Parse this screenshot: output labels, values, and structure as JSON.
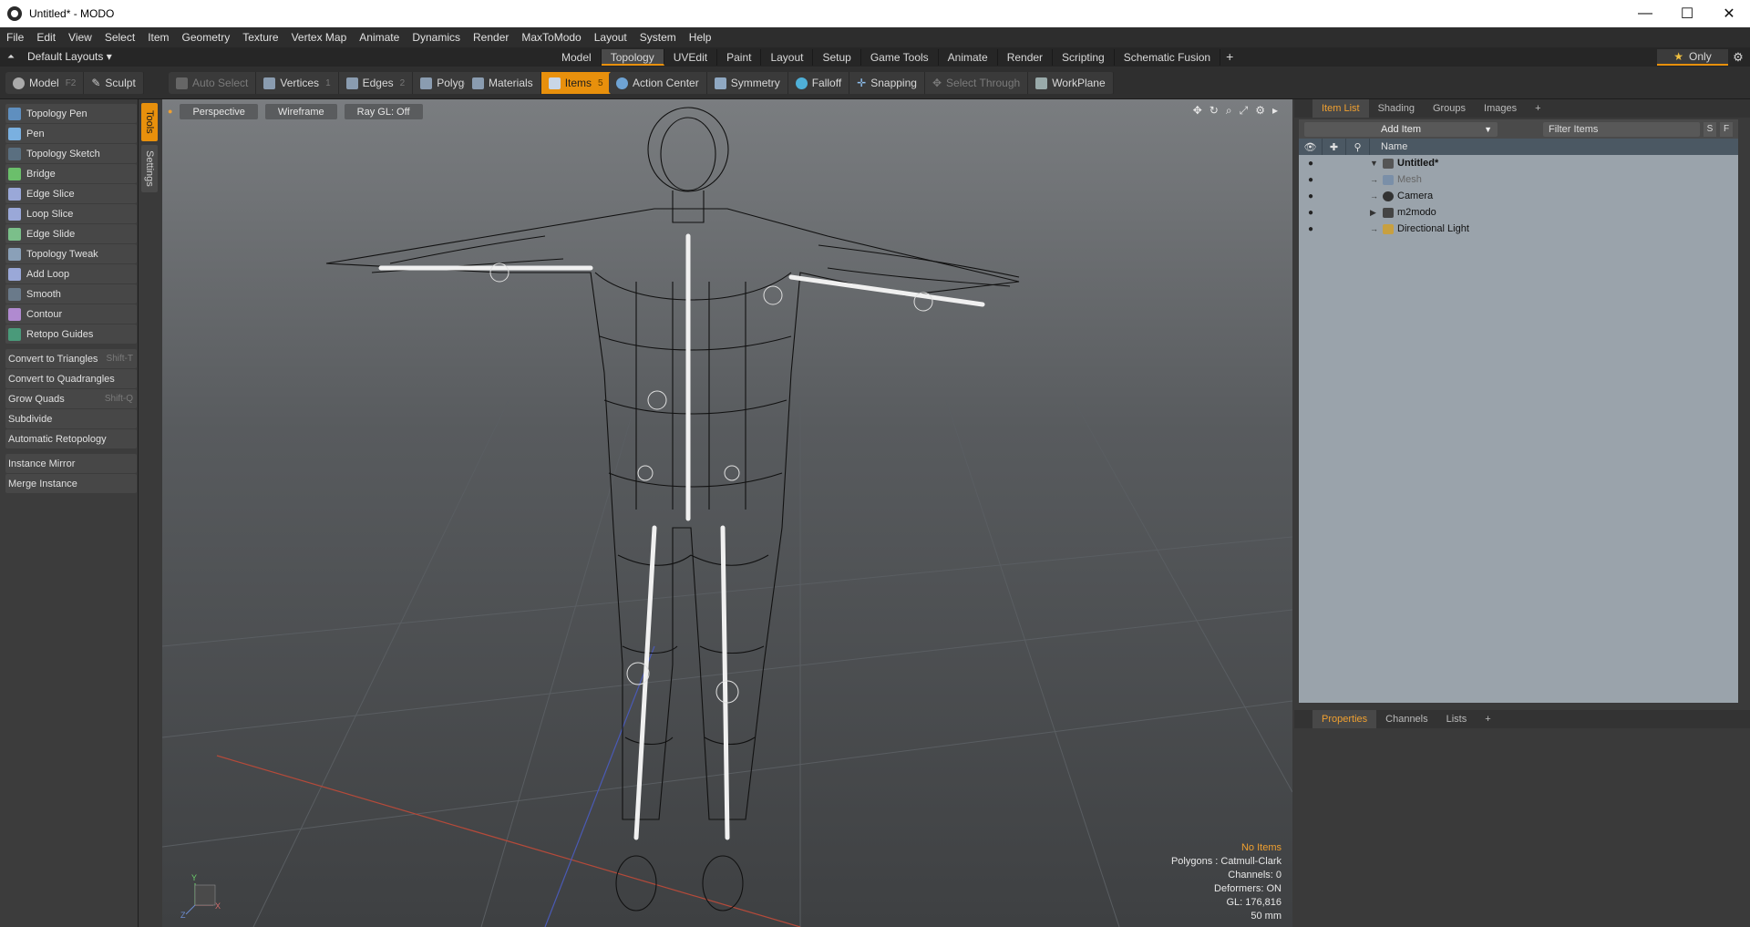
{
  "window": {
    "title": "Untitled* - MODO",
    "controls": [
      "—",
      "☐",
      "✕"
    ]
  },
  "menu": [
    "File",
    "Edit",
    "View",
    "Select",
    "Item",
    "Geometry",
    "Texture",
    "Vertex Map",
    "Animate",
    "Dynamics",
    "Render",
    "MaxToModo",
    "Layout",
    "System",
    "Help"
  ],
  "layout": {
    "dropdown": "Default Layouts ▾",
    "tabs": [
      "Model",
      "Topology",
      "UVEdit",
      "Paint",
      "Layout",
      "Setup",
      "Game Tools",
      "Animate",
      "Render",
      "Scripting",
      "Schematic Fusion"
    ],
    "active_tab": "Topology",
    "plus": "+",
    "only_label": "Only",
    "star": "★",
    "gear": "⚙"
  },
  "toolbar": {
    "model": "Model",
    "model_key": "F2",
    "sculpt": "Sculpt",
    "auto_select": "Auto Select",
    "vertices": "Vertices",
    "vertices_key": "1",
    "edges": "Edges",
    "edges_key": "2",
    "polygons": "Polygons",
    "materials": "Materials",
    "items": "Items",
    "items_key": "5",
    "action_center": "Action Center",
    "symmetry": "Symmetry",
    "falloff": "Falloff",
    "snapping": "Snapping",
    "select_through": "Select Through",
    "workplane": "WorkPlane"
  },
  "tools": {
    "icon_tools": [
      "Topology Pen",
      "Pen",
      "Topology Sketch",
      "Bridge",
      "Edge Slice",
      "Loop Slice",
      "Edge Slide",
      "Topology Tweak",
      "Add Loop",
      "Smooth",
      "Contour",
      "Retopo Guides"
    ],
    "plain_tools": [
      {
        "label": "Convert to Triangles",
        "shortcut": "Shift-T"
      },
      {
        "label": "Convert to Quadrangles",
        "shortcut": ""
      },
      {
        "label": "Grow Quads",
        "shortcut": "Shift-Q"
      },
      {
        "label": "Subdivide",
        "shortcut": ""
      },
      {
        "label": "Automatic Retopology",
        "shortcut": ""
      }
    ],
    "instance_tools": [
      "Instance Mirror",
      "Merge Instance"
    ],
    "side_tabs": [
      "Tools",
      "Settings"
    ]
  },
  "viewport": {
    "view": "Perspective",
    "shading": "Wireframe",
    "raygl": "Ray GL: Off",
    "icons": [
      "✥",
      "↻",
      "⌕",
      "⤢",
      "⚙",
      "▸"
    ],
    "info": {
      "no_items": "No Items",
      "polygons": "Polygons : Catmull-Clark",
      "channels": "Channels: 0",
      "deformers": "Deformers: ON",
      "gl": "GL: 176,816",
      "focal": "50 mm"
    },
    "axis": {
      "y": "Y",
      "z": "Z",
      "x": "X"
    }
  },
  "item_list": {
    "tabs": [
      "Item List",
      "Shading",
      "Groups",
      "Images",
      "+"
    ],
    "add_item": "Add Item",
    "filter_placeholder": "Filter Items",
    "s_btn": "S",
    "f_btn": "F",
    "name_header": "Name",
    "rows": [
      "Untitled*",
      "Mesh",
      "Camera",
      "m2modo",
      "Directional Light"
    ]
  },
  "properties": {
    "tabs": [
      "Properties",
      "Channels",
      "Lists",
      "+"
    ]
  }
}
